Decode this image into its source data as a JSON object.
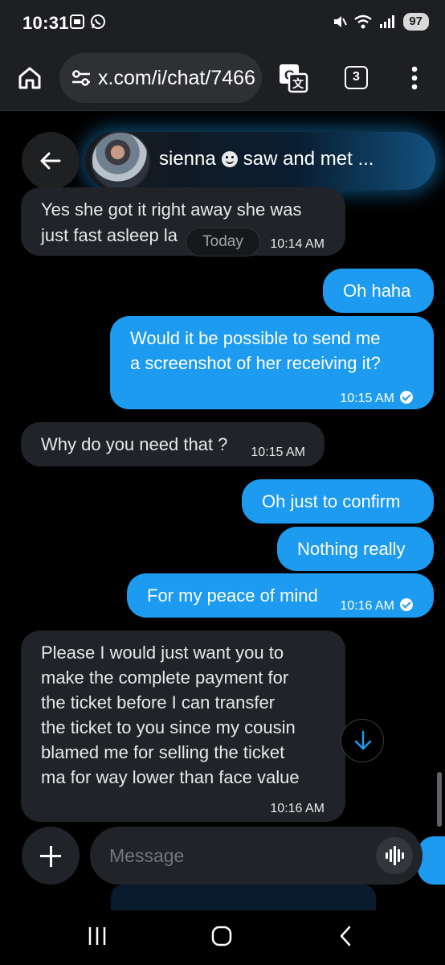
{
  "status_bar": {
    "time": "10:31",
    "battery": "97",
    "wifi_label": "6"
  },
  "browser": {
    "url": "x.com/i/chat/7466",
    "tab_count": "3"
  },
  "chat": {
    "name": "sienna",
    "name_suffix": "saw and met ...",
    "date_chip": "Today",
    "messages": [
      {
        "side": "received",
        "text_line1": "Yes she got it right away she was",
        "text_line2": "just fast asleep la",
        "time": "10:14 AM"
      },
      {
        "side": "sent",
        "text": "Oh haha"
      },
      {
        "side": "sent",
        "text_line1": "Would it be possible to send me",
        "text_line2": "a screenshot of her receiving it?",
        "time": "10:15 AM"
      },
      {
        "side": "received",
        "text": "Why do you need that ?",
        "time": "10:15 AM"
      },
      {
        "side": "sent",
        "text": "Oh just to confirm"
      },
      {
        "side": "sent",
        "text": "Nothing really"
      },
      {
        "side": "sent",
        "text": "For my peace of mind",
        "time": "10:16 AM"
      },
      {
        "side": "received",
        "lines": [
          "Please I would just want you to",
          "make the complete payment for",
          "the ticket before I can transfer",
          "the ticket to you since my cousin",
          "blamed me for selling the ticket",
          "ma for way lower than face value"
        ],
        "time": "10:16 AM"
      }
    ]
  },
  "composer": {
    "placeholder": "Message"
  },
  "icons": {
    "home": "home-icon",
    "translate": "translate-icon",
    "menu": "more-vert-icon",
    "back": "arrow-left-icon",
    "scroll": "arrow-down-icon",
    "voice": "voice-wave-icon"
  },
  "colors": {
    "accent": "#1d9bf0",
    "received_bubble": "#202327",
    "background": "#000000"
  }
}
